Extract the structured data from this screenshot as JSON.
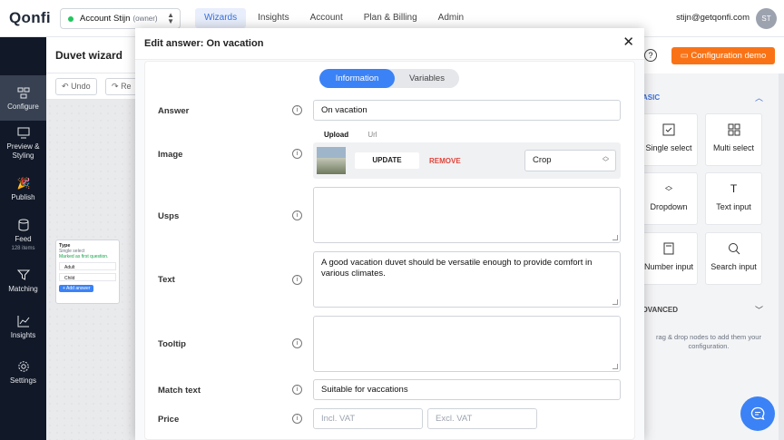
{
  "app": {
    "logo": "Qonfi"
  },
  "account": {
    "name": "Account Stijn",
    "role": "(owner)"
  },
  "nav": {
    "items": [
      "Wizards",
      "Insights",
      "Account",
      "Plan & Billing",
      "Admin"
    ]
  },
  "user": {
    "email": "stijn@getqonfi.com",
    "initials": "ST"
  },
  "sidebar": {
    "configure": "Configure",
    "preview": "Preview &",
    "preview2": "Styling",
    "publish": "Publish",
    "feed": "Feed",
    "feed_count": "128 items",
    "matching": "Matching",
    "insights": "Insights",
    "settings": "Settings"
  },
  "canvas": {
    "title": "Duvet wizard",
    "undo": "Undo",
    "redo": "Re"
  },
  "node": {
    "title": "Type",
    "subtitle": "Single select",
    "note": "Marked as first question.",
    "options": [
      "Adult",
      "Child"
    ],
    "add": "+ Add answer"
  },
  "right": {
    "help": "?",
    "demo": "Configuration demo",
    "basic": "ASIC",
    "advanced": "DVANCED",
    "tiles": [
      "Single select",
      "Multi select",
      "Dropdown",
      "Text input",
      "Number input",
      "Search input"
    ],
    "hint": "rag & drop nodes to add them your configuration."
  },
  "modal": {
    "title": "Edit answer: On vacation",
    "tabs": {
      "information": "Information",
      "variables": "Variables"
    },
    "labels": {
      "answer": "Answer",
      "image": "Image",
      "usps": "Usps",
      "text": "Text",
      "tooltip": "Tooltip",
      "match_text": "Match text",
      "price": "Price"
    },
    "answer_value": "On vacation",
    "upload_tabs": {
      "upload": "Upload",
      "url": "Url"
    },
    "update": "UPDATE",
    "remove": "REMOVE",
    "crop": "Crop",
    "text_value": "A good vacation duvet should be versatile enough to provide comfort in various climates.",
    "match_text_value": "Suitable for vaccations",
    "price_incl_placeholder": "Incl. VAT",
    "price_excl_placeholder": "Excl. VAT"
  }
}
